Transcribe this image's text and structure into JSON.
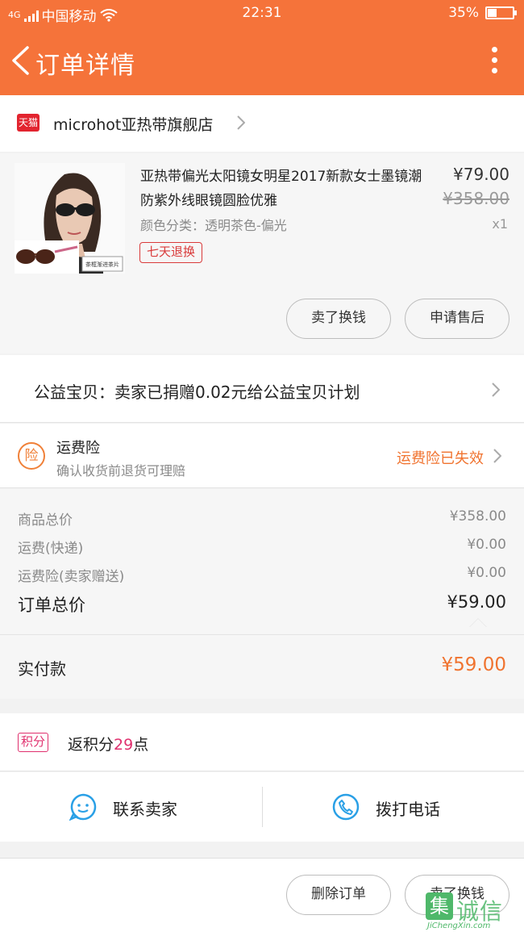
{
  "status_bar": {
    "network": "4G",
    "carrier": "中国移动",
    "time": "22:31",
    "battery_text": "35%",
    "battery_level": 0.35
  },
  "nav": {
    "title": "订单详情"
  },
  "shop": {
    "badge": "天猫",
    "name": "microhot亚热带旗舰店"
  },
  "product": {
    "title": "亚热带偏光太阳镜女明星2017新款女士墨镜潮防紫外线眼镜圆脸优雅",
    "spec": "颜色分类：透明茶色-偏光",
    "tag": "七天退换",
    "price": "¥79.00",
    "original_price": "¥358.00",
    "quantity": "x1",
    "thumb_label": "茶框渐进茶片",
    "actions": [
      "卖了换钱",
      "申请售后"
    ]
  },
  "charity": {
    "text": "公益宝贝：卖家已捐赠0.02元给公益宝贝计划"
  },
  "insurance": {
    "icon_char": "险",
    "title": "运费险",
    "subtitle": "确认收货前退货可理赔",
    "status": "运费险已失效"
  },
  "summary": {
    "rows": [
      {
        "label": "商品总价",
        "value": "¥358.00"
      },
      {
        "label": "运费(快递)",
        "value": "¥0.00"
      },
      {
        "label": "运费险(卖家赠送)",
        "value": "¥0.00"
      }
    ],
    "total_label": "订单总价",
    "total_value": "¥59.00",
    "paid_label": "实付款",
    "paid_value": "¥59.00"
  },
  "points": {
    "badge": "积分",
    "prefix": "返积分",
    "value": "29",
    "suffix": "点"
  },
  "contact": {
    "seller_label": "联系卖家",
    "phone_label": "拨打电话"
  },
  "footer": {
    "actions": [
      "删除订单",
      "卖了换钱"
    ]
  },
  "watermark": {
    "char": "集",
    "text": "诚信",
    "sub": "JiChengXin.com"
  },
  "colors": {
    "brand": "#f5733a",
    "price_accent": "#f0732f",
    "points_accent": "#e0306e",
    "tag_red": "#d93a3a"
  }
}
